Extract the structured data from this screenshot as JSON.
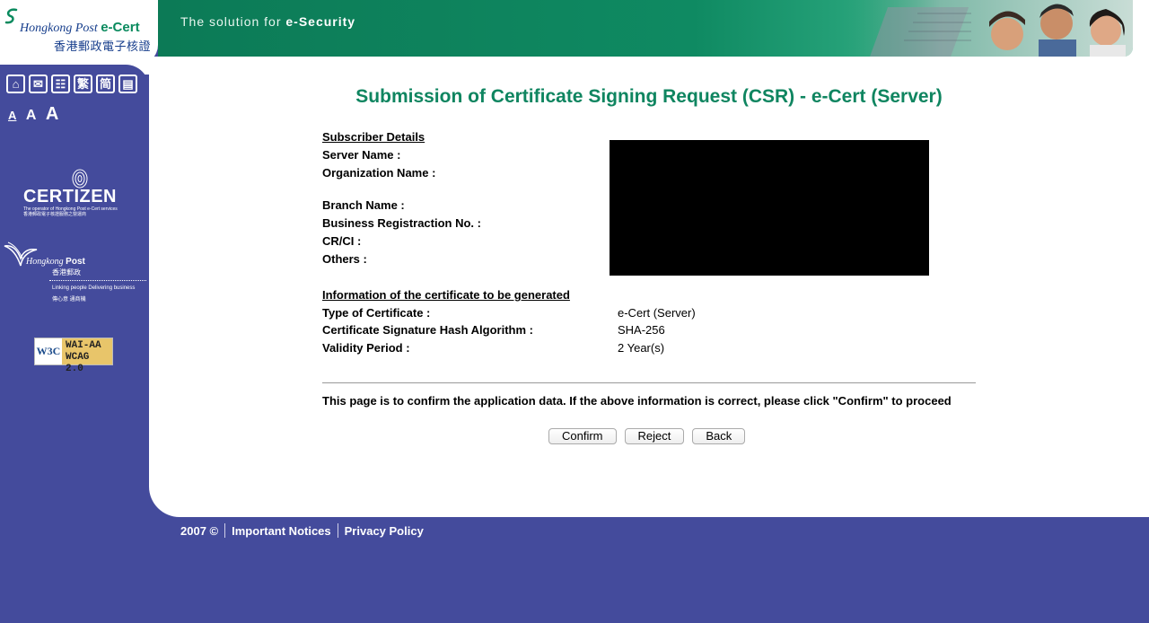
{
  "header": {
    "logo_text": "Hongkong Post",
    "logo_product": "e-Cert",
    "logo_chinese": "香港郵政電子核證",
    "tagline_prefix": "The solution for ",
    "tagline_emphasis": "e-Security"
  },
  "sidebar": {
    "tools": [
      {
        "icon": "home-icon",
        "glyph": "⌂"
      },
      {
        "icon": "mail-icon",
        "glyph": "✉"
      },
      {
        "icon": "sitemap-icon",
        "glyph": "☷"
      },
      {
        "icon": "traditional-chinese-icon",
        "glyph": "繁"
      },
      {
        "icon": "simplified-chinese-icon",
        "glyph": "简"
      },
      {
        "icon": "text-version-icon",
        "glyph": "▤"
      }
    ],
    "font_sizes": [
      "A",
      "A",
      "A"
    ],
    "certizen": {
      "name": "CERTIZEN",
      "sub_en": "The operator of Hongkong Post e-Cert services",
      "sub_zh": "香港郵政電子核證服務之營運商"
    },
    "hkpost": {
      "name_italic": "Hongkong",
      "name_bold": "Post",
      "name_zh": "香港郵政",
      "slogan_en": "Linking people Delivering business",
      "slogan_zh": "傳心意 通商機"
    },
    "w3c_badge": {
      "w3c": "W3C",
      "line1": "WAI-AA",
      "line2": "WCAG 2.0"
    }
  },
  "main": {
    "title": "Submission of Certificate Signing Request (CSR) - e-Cert (Server)",
    "subscriber_heading": "Subscriber Details",
    "subscriber_fields": [
      "Server Name :",
      "Organization Name :",
      "Branch Name :",
      "Business Registraction No. :",
      "CR/CI :",
      "Others :"
    ],
    "certificate_heading": "Information of the certificate to be generated",
    "certificate_fields": [
      {
        "label": "Type of Certificate :",
        "value": "e-Cert (Server)"
      },
      {
        "label": "Certificate Signature Hash Algorithm :",
        "value": "SHA-256"
      },
      {
        "label": "Validity Period :",
        "value": "2 Year(s)"
      }
    ],
    "confirm_message": "This page is to confirm the application data. If the above information is correct, please click \"Confirm\" to proceed",
    "buttons": {
      "confirm": "Confirm",
      "reject": "Reject",
      "back": "Back"
    }
  },
  "footer": {
    "copyright": "2007 ©",
    "important_notices": "Important Notices",
    "privacy_policy": "Privacy Policy"
  }
}
